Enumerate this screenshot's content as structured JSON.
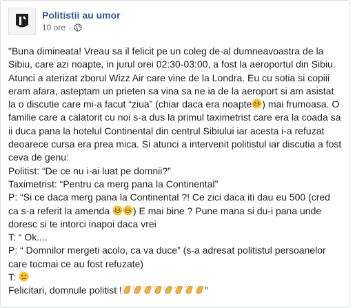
{
  "post": {
    "author": "Politistii au umor",
    "time": "10 ore",
    "separator": "·",
    "visibility_icon": "globe-icon",
    "colors": {
      "author": "#385898",
      "meta": "#616770",
      "text": "#1c1e21",
      "emoji_face": "#f7c231",
      "emoji_clap": "#f0b23a"
    },
    "paragraph_1_before_emoji": "\"Buna dimineata! Vreau sa il felicit pe un coleg de-al dumneavoastra de la Sibiu, care azi noapte, in jurul orei 02:30-03:00, a fost la aeroportul din Sibiu. Atunci a aterizat zborul Wizz Air care vine de la Londra. Eu cu sotia si copiii eram afara, asteptam un prieten sa vina sa ne ia de la aeroport si am asistat la o discutie care mi-a facut “ziua” (chiar daca era noapte",
    "paragraph_1_after_emoji": ") mai frumoasa. O familie care a calatorit cu noi s-a dus la primul taximetrist care era la coada sa ii duca pana la hotelul Continental din centrul Sibiului iar acesta i-a refuzat deoarece cursa era prea mica. Si atunci a intervenit politistul iar discutia a fost ceva de genu:",
    "line_1": "Politist: “De ce nu i-ai luat pe domnii?”",
    "line_2": "Taximetrist: “Pentru ca merg pana la Continental”",
    "line_3_before_emoji": "P: “Si ce daca merg pana la Continental ?! Ce zici daca iti dau eu 500 (cred ca s-a referit la amenda ",
    "line_3_after_emoji": ") E mai bine ? Pune mana si du-i pana unde doresc si te intorci inapoi daca vrei",
    "line_4": "T: “ Ok....",
    "line_5": "P: “ Domnilor mergeti acolo, ca va duce” (s-a adresat politistul persoanelor care tocmai ce au fost refuzate)",
    "line_6_before_emoji": "T: ",
    "line_7_before_emoji": "Felicitari, domnule politist !",
    "line_7_after_emoji": "\"",
    "emojis": {
      "grin": "grinning-face-icon",
      "smile": "smiling-face-icon",
      "confused": "confused-face-icon",
      "clap": "clapping-hands-icon",
      "clap_count": 8
    }
  }
}
